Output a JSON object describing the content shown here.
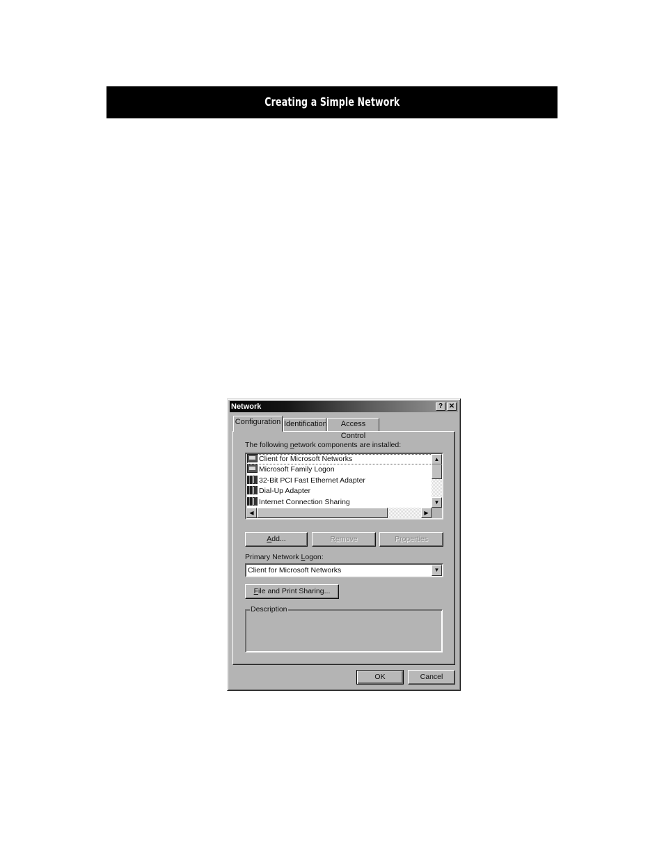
{
  "page": {
    "banner_title": "Creating a Simple Network"
  },
  "dialog": {
    "title": "Network",
    "help_button": "?",
    "close_button": "✕",
    "tabs": [
      {
        "label": "Configuration",
        "active": true
      },
      {
        "label": "Identification",
        "active": false
      },
      {
        "label": "Access Control",
        "active": false
      }
    ],
    "components_label_pre": "The following ",
    "components_label_mnemonic": "n",
    "components_label_post": "etwork components are installed:",
    "components": [
      {
        "label": "Client for Microsoft Networks",
        "icon": "client-computer-icon",
        "focused": true
      },
      {
        "label": "Microsoft Family Logon",
        "icon": "client-computer-icon",
        "focused": false
      },
      {
        "label": "32-Bit PCI Fast Ethernet Adapter",
        "icon": "network-adapter-icon",
        "focused": false
      },
      {
        "label": "Dial-Up Adapter",
        "icon": "network-adapter-icon",
        "focused": false
      },
      {
        "label": "Internet Connection Sharing",
        "icon": "network-adapter-icon",
        "focused": false
      }
    ],
    "scroll_up": "▲",
    "scroll_down": "▼",
    "scroll_left": "◀",
    "scroll_right": "▶",
    "buttons": {
      "add": {
        "mnemonic": "A",
        "rest": "dd...",
        "enabled": true
      },
      "remove": {
        "pre": "R",
        "mnemonic": "e",
        "rest": "move",
        "enabled": false
      },
      "properties": {
        "pre": "P",
        "mnemonic": "r",
        "rest": "operties",
        "enabled": false
      },
      "file_print": {
        "mnemonic": "F",
        "rest": "ile and Print Sharing...",
        "enabled": true
      },
      "ok": "OK",
      "cancel": "Cancel"
    },
    "primary_logon_label_pre": "Primary Network ",
    "primary_logon_label_mnemonic": "L",
    "primary_logon_label_post": "ogon:",
    "primary_logon_value": "Client for Microsoft Networks",
    "dropdown_arrow": "▼",
    "description_legend": "Description",
    "description_text": ""
  }
}
